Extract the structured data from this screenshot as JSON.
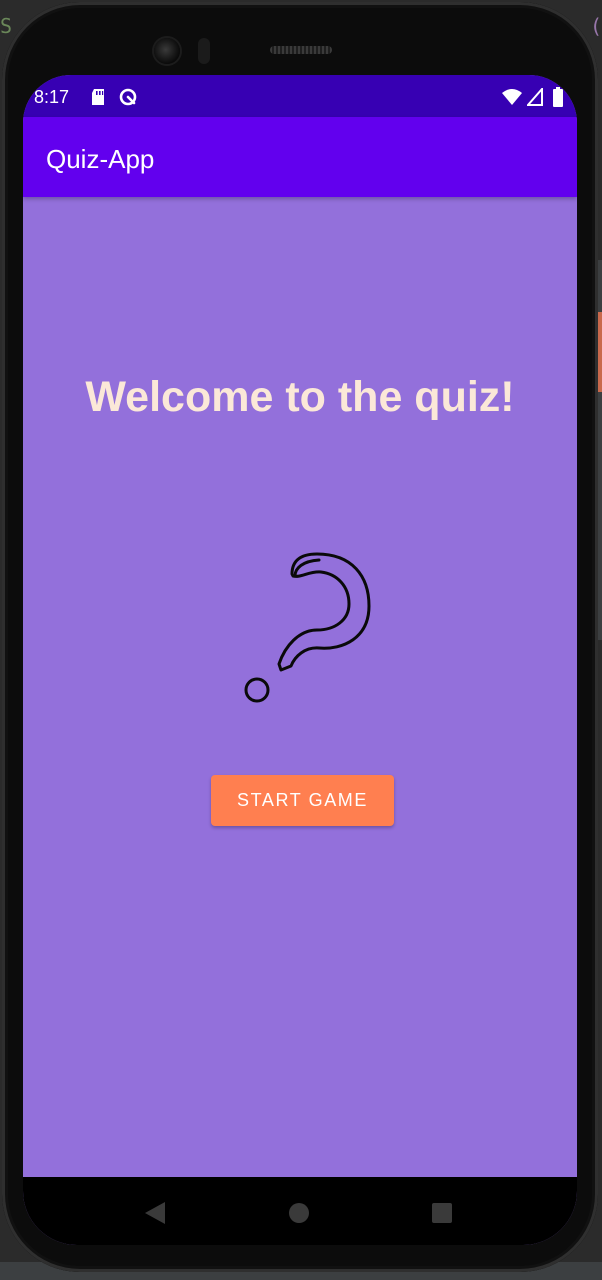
{
  "status_bar": {
    "time": "8:17",
    "icons": [
      "sd-card-icon",
      "sync-icon",
      "wifi-icon",
      "signal-icon",
      "battery-icon"
    ]
  },
  "app_bar": {
    "title": "Quiz-App"
  },
  "main": {
    "welcome_text": "Welcome to the quiz!",
    "illustration": "question-mark-icon",
    "start_button_label": "START GAME"
  },
  "nav_bar": {
    "buttons": [
      "back-icon",
      "home-icon",
      "recents-icon"
    ]
  },
  "colors": {
    "status_bar": "#3700b3",
    "app_bar": "#6200ee",
    "background": "#9370db",
    "welcome_text": "#fbe8d8",
    "button": "#ff7f50",
    "button_text": "#ffffff"
  }
}
